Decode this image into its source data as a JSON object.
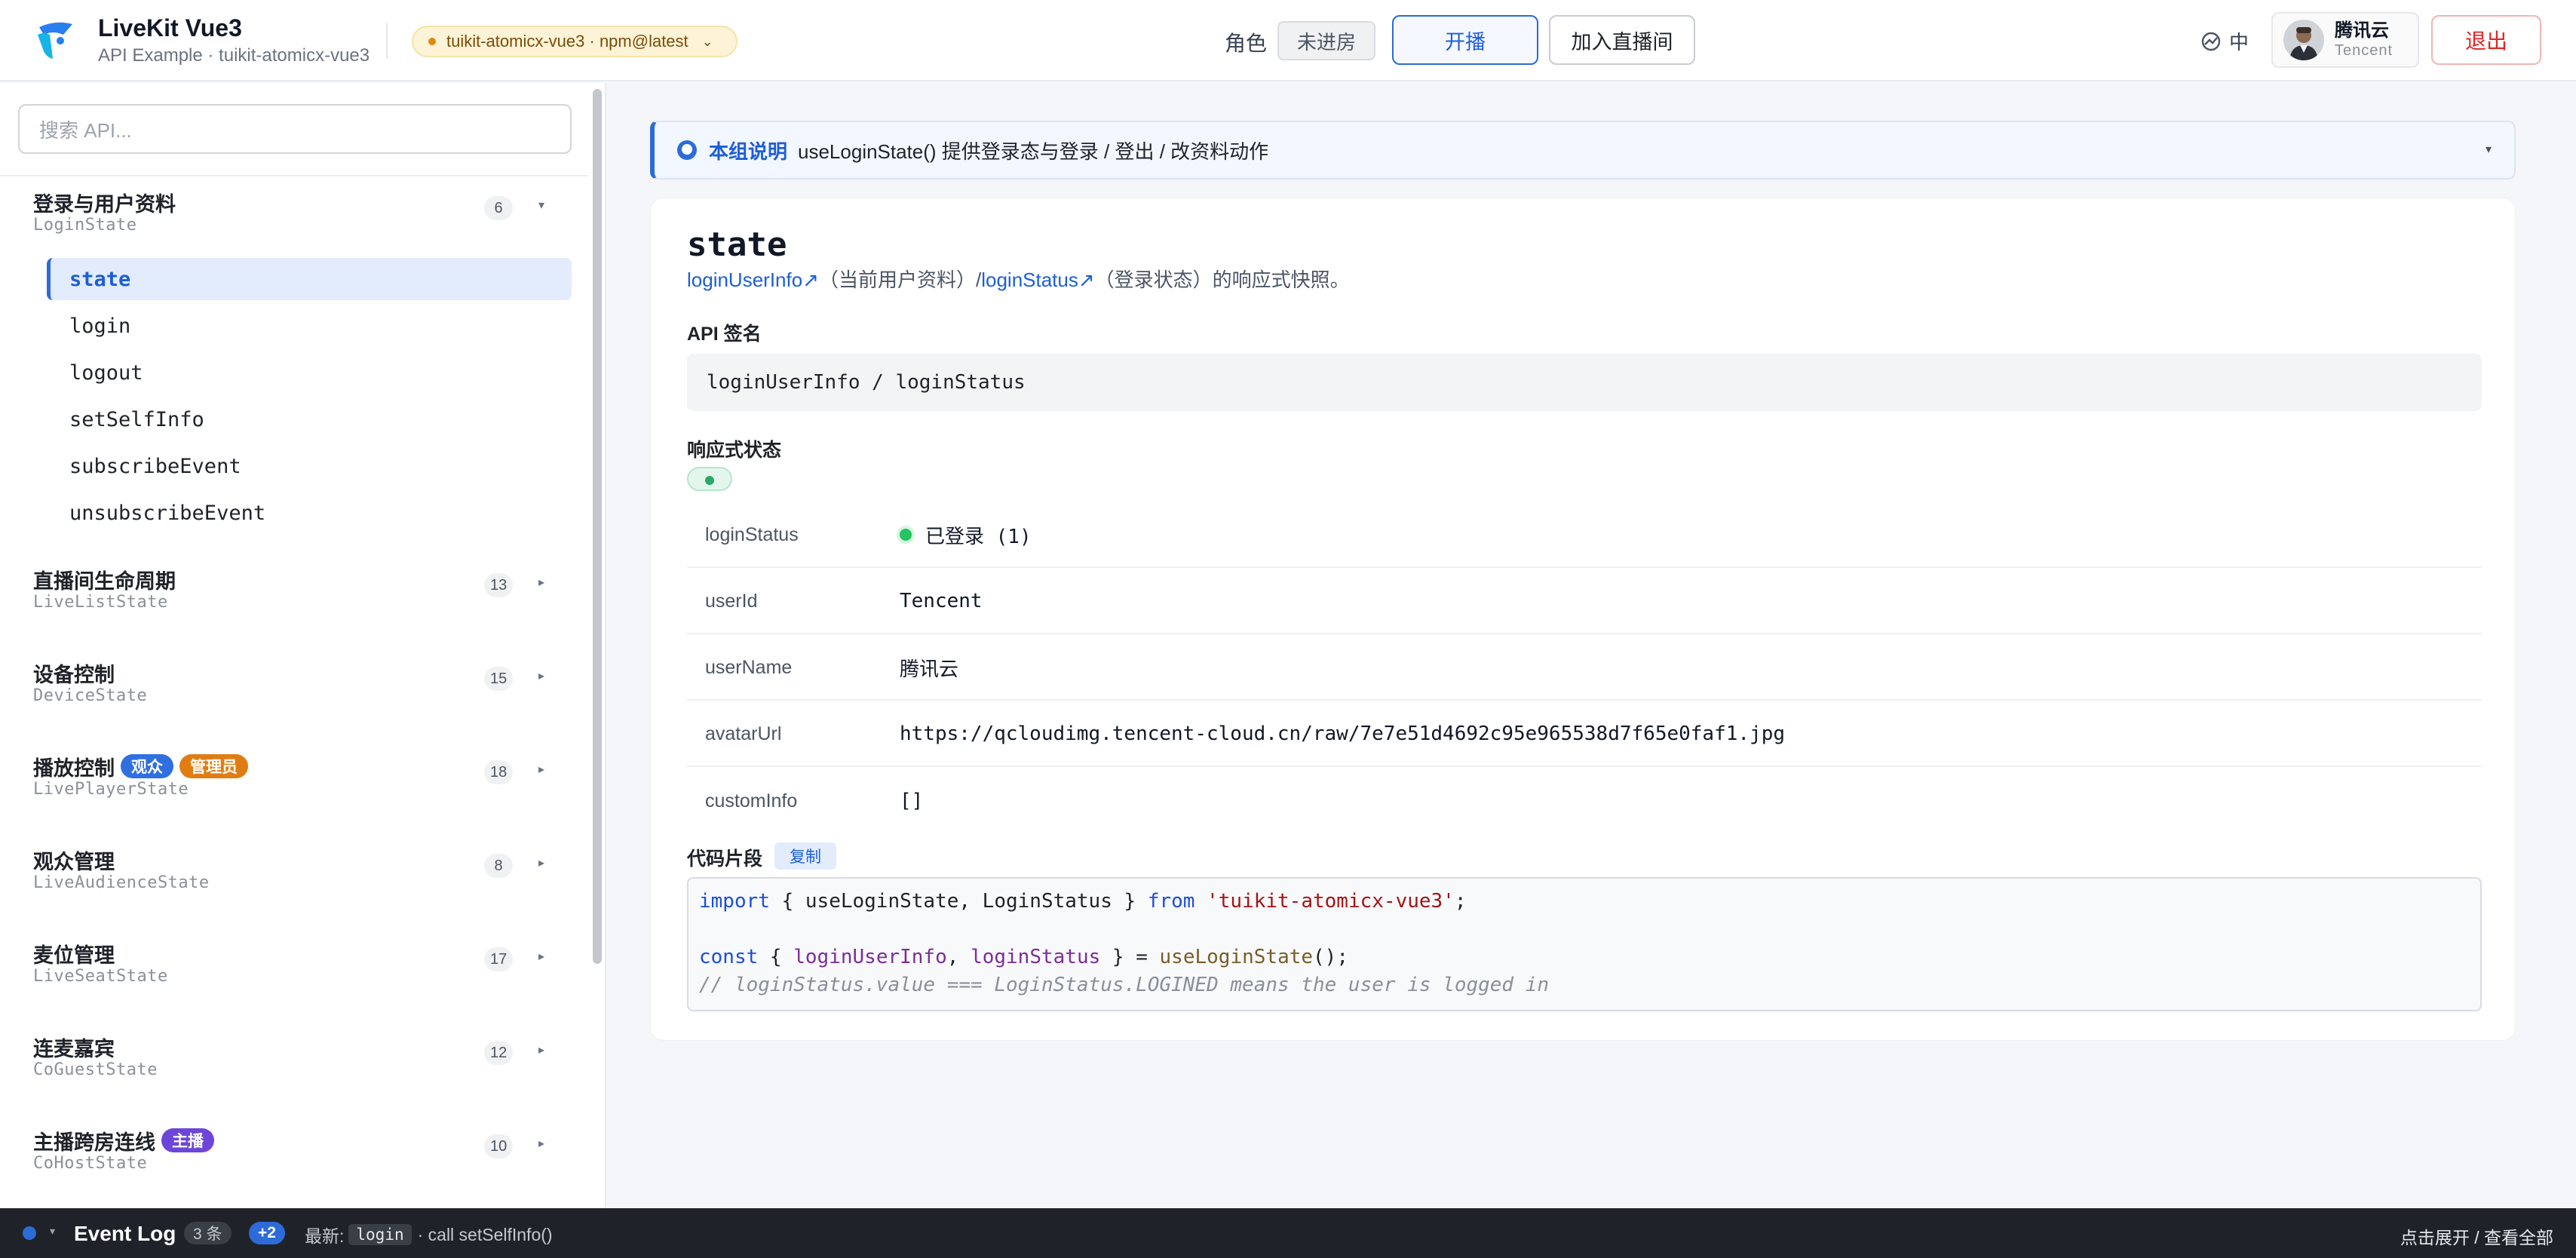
{
  "header": {
    "app_title": "LiveKit Vue3",
    "app_subtitle": "API Example · tuikit-atomicx-vue3",
    "package_badge": "tuikit-atomicx-vue3 · npm@latest",
    "role_label": "角色",
    "role_value": "未进房",
    "start_live_label": "开播",
    "join_live_label": "加入直播间",
    "language_label": "中",
    "user_name": "腾讯云",
    "user_id": "Tencent",
    "logout_label": "退出"
  },
  "sidebar": {
    "search_placeholder": "搜索 API...",
    "groups": [
      {
        "title": "登录与用户资料",
        "sub": "LoginState",
        "count": "6",
        "expanded": true
      },
      {
        "title": "直播间生命周期",
        "sub": "LiveListState",
        "count": "13"
      },
      {
        "title": "设备控制",
        "sub": "DeviceState",
        "count": "15"
      },
      {
        "title": "播放控制",
        "sub": "LivePlayerState",
        "count": "18",
        "tags": [
          "观众",
          "管理员"
        ]
      },
      {
        "title": "观众管理",
        "sub": "LiveAudienceState",
        "count": "8"
      },
      {
        "title": "麦位管理",
        "sub": "LiveSeatState",
        "count": "17"
      },
      {
        "title": "连麦嘉宾",
        "sub": "CoGuestState",
        "count": "12"
      },
      {
        "title": "主播跨房连线",
        "sub": "CoHostState",
        "count": "10",
        "tags": [
          "主播"
        ]
      }
    ],
    "login_items": [
      "state",
      "login",
      "logout",
      "setSelfInfo",
      "subscribeEvent",
      "unsubscribeEvent"
    ]
  },
  "info_bar": {
    "label": "本组说明",
    "text": "useLoginState() 提供登录态与登录 / 登出 / 改资料动作"
  },
  "detail": {
    "title": "state",
    "desc_link1": "loginUserInfo↗",
    "desc_mid": "（当前用户资料）/",
    "desc_link2": "loginStatus↗",
    "desc_tail": "（登录状态）的响应式快照。",
    "signature_label": "API 签名",
    "signature": "loginUserInfo / loginStatus",
    "reactive_label": "响应式状态",
    "rows": [
      {
        "key": "loginStatus",
        "value": "已登录 (1)"
      },
      {
        "key": "userId",
        "value": "Tencent"
      },
      {
        "key": "userName",
        "value": "腾讯云"
      },
      {
        "key": "avatarUrl",
        "value": "https://qcloudimg.tencent-cloud.cn/raw/7e7e51d4692c95e965538d7f65e0faf1.jpg"
      },
      {
        "key": "customInfo",
        "value": "[]"
      }
    ],
    "code_label": "代码片段",
    "copy_label": "复制",
    "code": {
      "l1_import": "import",
      "l1_body": " { useLoginState, LoginStatus } ",
      "l1_from": "from",
      "l1_str": "'tuikit-atomicx-vue3'",
      "l1_end": ";",
      "l3_const": "const",
      "l3_open": " { ",
      "l3_var1": "loginUserInfo",
      "l3_comma": ", ",
      "l3_var2": "loginStatus",
      "l3_eq": " } = ",
      "l3_fn": "useLoginState",
      "l3_end": "();",
      "l4_comment": "// loginStatus.value === LoginStatus.LOGINED means the user is logged in"
    }
  },
  "event_log": {
    "title": "Event Log",
    "count": "3 条",
    "new_count": "+2",
    "latest_label": "最新:",
    "latest_code": "login",
    "latest_text": "· call setSelfInfo()",
    "right_text": "点击展开 / 查看全部"
  }
}
